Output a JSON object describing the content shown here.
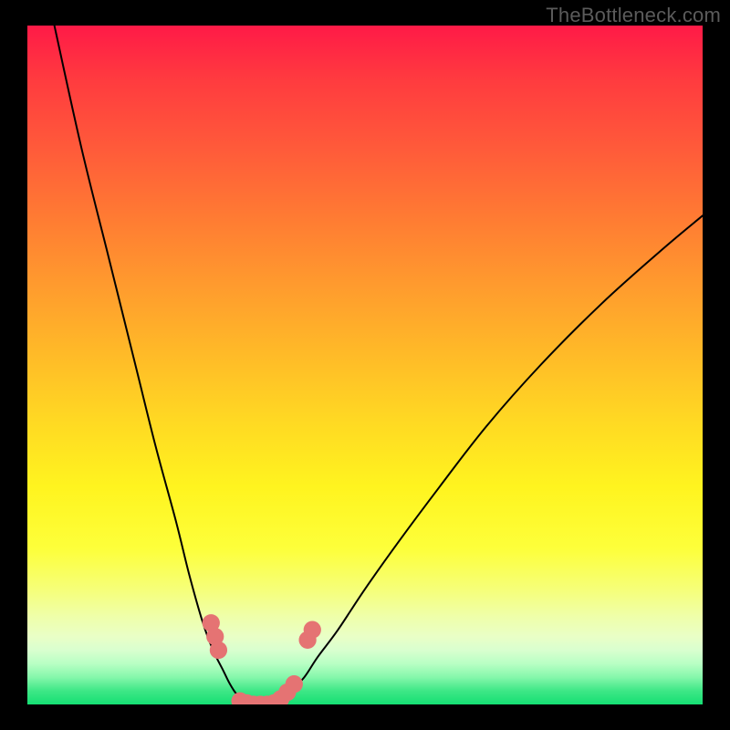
{
  "watermark": "TheBottleneck.com",
  "chart_data": {
    "type": "line",
    "title": "",
    "xlabel": "",
    "ylabel": "",
    "xlim": [
      0,
      100
    ],
    "ylim": [
      0,
      100
    ],
    "grid": false,
    "legend": false,
    "series": [
      {
        "name": "left-curve",
        "color": "#000000",
        "x": [
          4,
          8,
          12,
          16,
          19,
          22,
          24,
          26,
          27.5,
          29,
          30,
          31,
          32,
          33,
          34
        ],
        "y": [
          100,
          82,
          66,
          50,
          38,
          27,
          19,
          12,
          8,
          5,
          3,
          1.5,
          0.7,
          0.2,
          0
        ]
      },
      {
        "name": "right-curve",
        "color": "#000000",
        "x": [
          36,
          37,
          38,
          39,
          41,
          43,
          46,
          50,
          55,
          61,
          68,
          76,
          85,
          94,
          100
        ],
        "y": [
          0,
          0.3,
          1,
          2,
          4,
          7,
          11,
          17,
          24,
          32,
          41,
          50,
          59,
          67,
          72
        ]
      }
    ],
    "markers": [
      {
        "name": "valley-markers",
        "color": "#e57373",
        "radius": 1.3,
        "points": [
          {
            "x": 27.2,
            "y": 12
          },
          {
            "x": 27.8,
            "y": 10
          },
          {
            "x": 28.3,
            "y": 8
          },
          {
            "x": 31.5,
            "y": 0.5
          },
          {
            "x": 32.5,
            "y": 0.2
          },
          {
            "x": 33.5,
            "y": 0
          },
          {
            "x": 34.5,
            "y": 0
          },
          {
            "x": 35.5,
            "y": 0
          },
          {
            "x": 36.5,
            "y": 0.2
          },
          {
            "x": 37.5,
            "y": 0.8
          },
          {
            "x": 38.5,
            "y": 1.8
          },
          {
            "x": 39.5,
            "y": 3
          },
          {
            "x": 41.5,
            "y": 9.5
          },
          {
            "x": 42.2,
            "y": 11
          }
        ]
      }
    ]
  }
}
